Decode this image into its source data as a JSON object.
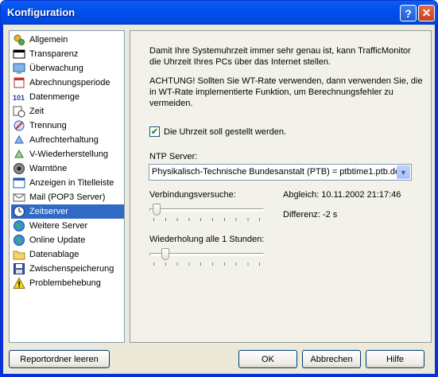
{
  "window": {
    "title": "Konfiguration"
  },
  "titlebar": {
    "help_label": "?",
    "close_label": "✕"
  },
  "sidebar": {
    "items": [
      {
        "label": "Allgemein",
        "icon": "settings-icon"
      },
      {
        "label": "Transparenz",
        "icon": "transparency-icon"
      },
      {
        "label": "Überwachung",
        "icon": "monitor-icon"
      },
      {
        "label": "Abrechnungsperiode",
        "icon": "calendar-icon"
      },
      {
        "label": "Datenmenge",
        "icon": "number-icon"
      },
      {
        "label": "Zeit",
        "icon": "clock-calendar-icon"
      },
      {
        "label": "Trennung",
        "icon": "disconnect-icon"
      },
      {
        "label": "Aufrechterhaltung",
        "icon": "keepalive-icon"
      },
      {
        "label": "V-Wiederherstellung",
        "icon": "reconnect-icon"
      },
      {
        "label": "Warntöne",
        "icon": "speaker-icon"
      },
      {
        "label": "Anzeigen in Titelleiste",
        "icon": "window-title-icon"
      },
      {
        "label": "Mail (POP3 Server)",
        "icon": "mail-icon"
      },
      {
        "label": "Zeitserver",
        "icon": "clock-icon"
      },
      {
        "label": "Weitere Server",
        "icon": "globe-icon"
      },
      {
        "label": "Online Update",
        "icon": "update-globe-icon"
      },
      {
        "label": "Datenablage",
        "icon": "folder-icon"
      },
      {
        "label": "Zwischenspeicherung",
        "icon": "floppy-disk-icon"
      },
      {
        "label": "Problembehebung",
        "icon": "warning-icon"
      }
    ]
  },
  "panel": {
    "intro": "Damit Ihre Systemuhrzeit immer sehr genau ist, kann TrafficMonitor die Uhrzeit Ihres PCs über das Internet stellen.",
    "warning": "ACHTUNG! Sollten Sie WT-Rate verwenden, dann verwenden Sie, die in WT-Rate implementierte Funktion, um Berechnungsfehler zu vermeiden.",
    "checkbox_label": "Die Uhrzeit soll gestellt werden.",
    "checkbox_checked": true,
    "ntp_label": "NTP Server:",
    "ntp_value": "Physikalisch-Technische Bundesanstalt (PTB) = ptbtime1.ptb.de",
    "attempts_label": "Verbindungsversuche:",
    "sync_text": "Abgleich: 10.11.2002 21:17:46",
    "difference_text": "Differenz: -2 s",
    "repeat_label": "Wiederholung alle 1 Stunden:"
  },
  "buttons": {
    "report": "Reportordner leeren",
    "ok": "OK",
    "cancel": "Abbrechen",
    "help": "Hilfe"
  },
  "colors": {
    "selection": "#316ac5",
    "titlebar": "#0050ee"
  }
}
